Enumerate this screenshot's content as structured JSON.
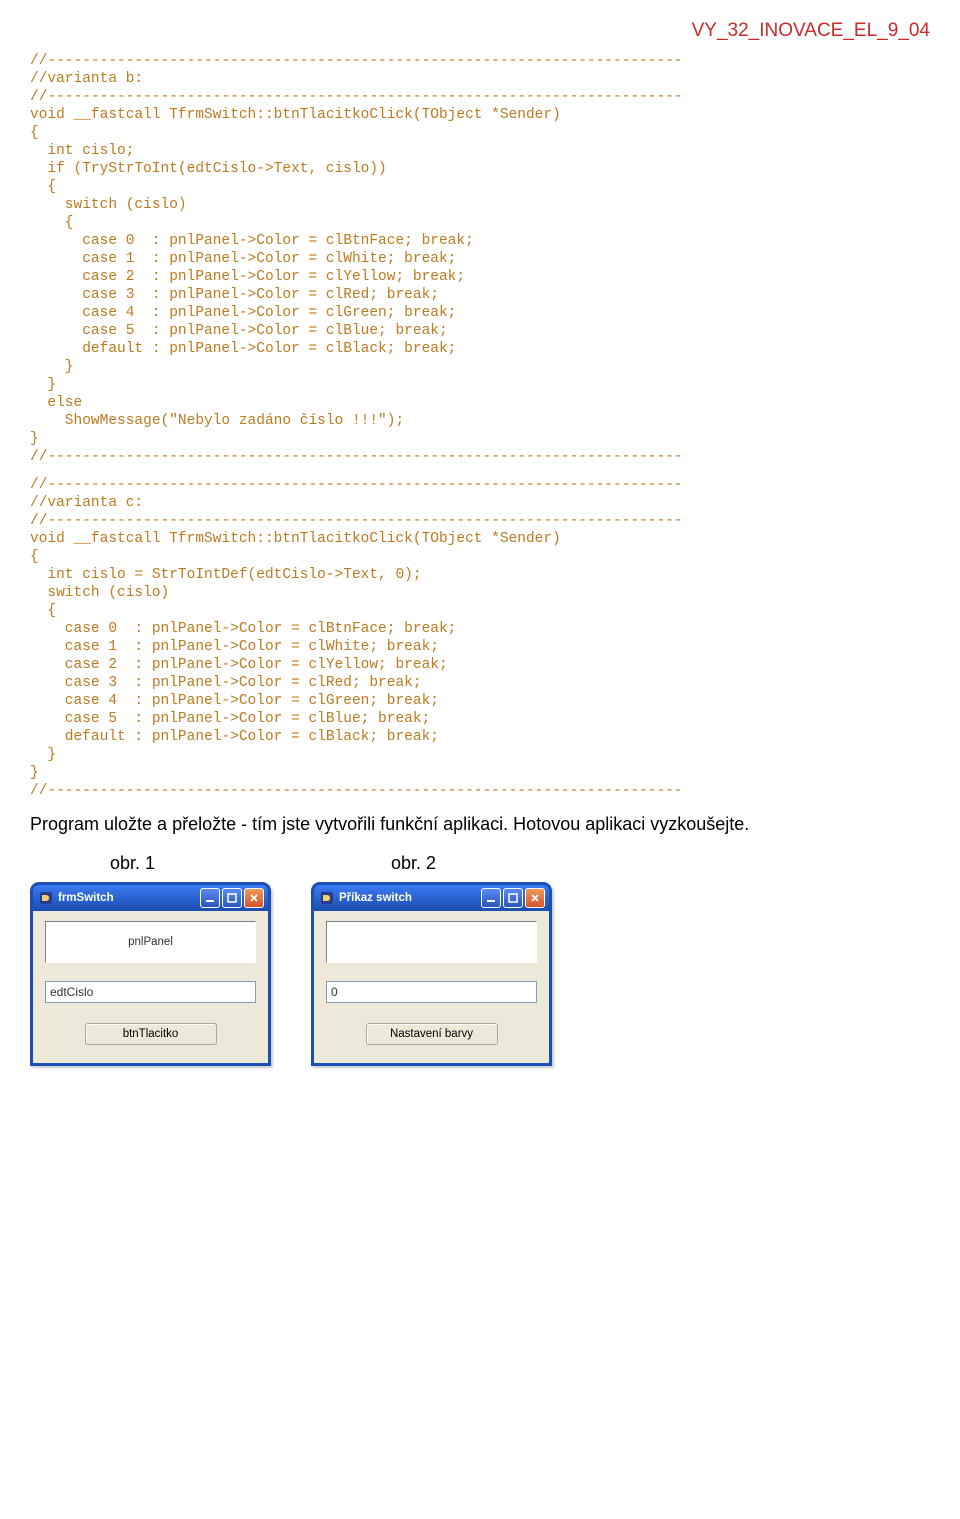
{
  "doc": {
    "id": "VY_32_INOVACE_EL_9_04"
  },
  "code": {
    "variant_b": "//-------------------------------------------------------------------------\n//varianta b:\n//-------------------------------------------------------------------------\nvoid __fastcall TfrmSwitch::btnTlacitkoClick(TObject *Sender)\n{\n  int cislo;\n  if (TryStrToInt(edtCislo->Text, cislo))\n  {\n    switch (cislo)\n    {\n      case 0  : pnlPanel->Color = clBtnFace; break;\n      case 1  : pnlPanel->Color = clWhite; break;\n      case 2  : pnlPanel->Color = clYellow; break;\n      case 3  : pnlPanel->Color = clRed; break;\n      case 4  : pnlPanel->Color = clGreen; break;\n      case 5  : pnlPanel->Color = clBlue; break;\n      default : pnlPanel->Color = clBlack; break;\n    }\n  }\n  else\n    ShowMessage(\"Nebylo zadáno číslo !!!\");\n}\n//-------------------------------------------------------------------------",
    "variant_c": "//-------------------------------------------------------------------------\n//varianta c:\n//-------------------------------------------------------------------------\nvoid __fastcall TfrmSwitch::btnTlacitkoClick(TObject *Sender)\n{\n  int cislo = StrToIntDef(edtCislo->Text, 0);\n  switch (cislo)\n  {\n    case 0  : pnlPanel->Color = clBtnFace; break;\n    case 1  : pnlPanel->Color = clWhite; break;\n    case 2  : pnlPanel->Color = clYellow; break;\n    case 3  : pnlPanel->Color = clRed; break;\n    case 4  : pnlPanel->Color = clGreen; break;\n    case 5  : pnlPanel->Color = clBlue; break;\n    default : pnlPanel->Color = clBlack; break;\n  }\n}\n//-------------------------------------------------------------------------"
  },
  "body": {
    "paragraph": "Program uložte a přeložte - tím jste vytvořili funkční aplikaci. Hotovou aplikaci vyzkoušejte."
  },
  "figures": {
    "left": {
      "caption": "obr. 1",
      "title": "frmSwitch",
      "panel_text": "pnlPanel",
      "input_value": "edtCislo",
      "button_label": "btnTlacitko"
    },
    "right": {
      "caption": "obr. 2",
      "title": "Příkaz switch",
      "panel_text": "",
      "input_value": "0",
      "button_label": "Nastavení barvy"
    }
  }
}
